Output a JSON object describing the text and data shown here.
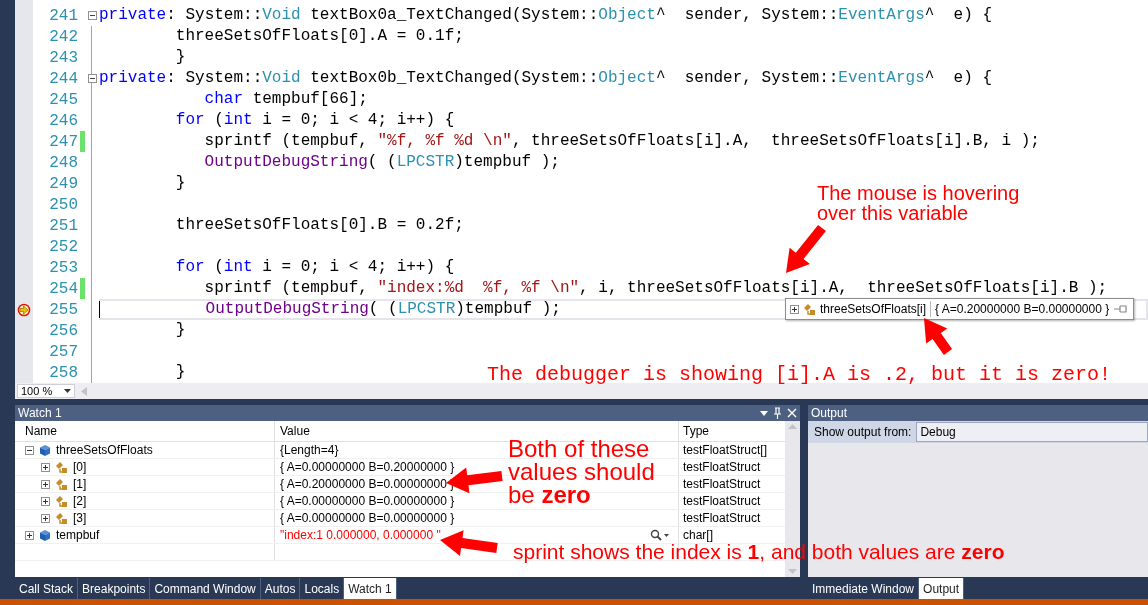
{
  "editor": {
    "lines": [
      {
        "number": "241",
        "collapsible": true,
        "changed": false,
        "current": false,
        "tokens": [
          {
            "kind": "kw",
            "text": "private"
          },
          {
            "kind": "plain",
            "text": ": System::"
          },
          {
            "kind": "type",
            "text": "Void"
          },
          {
            "kind": "plain",
            "text": " textBox0a_TextChanged(System::"
          },
          {
            "kind": "type",
            "text": "Object"
          },
          {
            "kind": "plain",
            "text": "^  sender, System::"
          },
          {
            "kind": "type",
            "text": "EventArgs"
          },
          {
            "kind": "plain",
            "text": "^  e) {"
          }
        ]
      },
      {
        "number": "242",
        "collapsible": false,
        "changed": false,
        "current": false,
        "tokens": [
          {
            "kind": "plain",
            "text": "        threeSetsOfFloats[0].A = 0.1f;"
          }
        ]
      },
      {
        "number": "243",
        "collapsible": false,
        "changed": false,
        "current": false,
        "tokens": [
          {
            "kind": "plain",
            "text": "        }"
          }
        ]
      },
      {
        "number": "244",
        "collapsible": true,
        "changed": false,
        "current": false,
        "tokens": [
          {
            "kind": "kw",
            "text": "private"
          },
          {
            "kind": "plain",
            "text": ": System::"
          },
          {
            "kind": "type",
            "text": "Void"
          },
          {
            "kind": "plain",
            "text": " textBox0b_TextChanged(System::"
          },
          {
            "kind": "type",
            "text": "Object"
          },
          {
            "kind": "plain",
            "text": "^  sender, System::"
          },
          {
            "kind": "type",
            "text": "EventArgs"
          },
          {
            "kind": "plain",
            "text": "^  e) {"
          }
        ]
      },
      {
        "number": "245",
        "collapsible": false,
        "changed": false,
        "current": false,
        "tokens": [
          {
            "kind": "kw",
            "text": "           char"
          },
          {
            "kind": "plain",
            "text": " tempbuf[66];"
          }
        ]
      },
      {
        "number": "246",
        "collapsible": false,
        "changed": false,
        "current": false,
        "tokens": [
          {
            "kind": "kw",
            "text": "        for"
          },
          {
            "kind": "plain",
            "text": " ("
          },
          {
            "kind": "kw",
            "text": "int"
          },
          {
            "kind": "plain",
            "text": " i = 0; i < 4; i++) {"
          }
        ]
      },
      {
        "number": "247",
        "collapsible": false,
        "changed": true,
        "current": false,
        "tokens": [
          {
            "kind": "plain",
            "text": "           sprintf (tempbuf, "
          },
          {
            "kind": "str",
            "text": "\"%f, %f %d \\n\""
          },
          {
            "kind": "plain",
            "text": ", threeSetsOfFloats[i].A,  threeSetsOfFloats[i].B, i );"
          }
        ]
      },
      {
        "number": "248",
        "collapsible": false,
        "changed": false,
        "current": false,
        "tokens": [
          {
            "kind": "fn",
            "text": "           OutputDebugString"
          },
          {
            "kind": "plain",
            "text": "( ("
          },
          {
            "kind": "type",
            "text": "LPCSTR"
          },
          {
            "kind": "plain",
            "text": ")tempbuf );"
          }
        ]
      },
      {
        "number": "249",
        "collapsible": false,
        "changed": false,
        "current": false,
        "tokens": [
          {
            "kind": "plain",
            "text": "        }"
          }
        ]
      },
      {
        "number": "250",
        "collapsible": false,
        "changed": false,
        "current": false
      },
      {
        "number": "251",
        "collapsible": false,
        "changed": false,
        "current": false,
        "tokens": [
          {
            "kind": "plain",
            "text": "        threeSetsOfFloats[0].B = 0.2f;"
          }
        ]
      },
      {
        "number": "252",
        "collapsible": false,
        "changed": false,
        "current": false
      },
      {
        "number": "253",
        "collapsible": false,
        "changed": false,
        "current": false,
        "tokens": [
          {
            "kind": "kw",
            "text": "        for"
          },
          {
            "kind": "plain",
            "text": " ("
          },
          {
            "kind": "kw",
            "text": "int"
          },
          {
            "kind": "plain",
            "text": " i = 0; i < 4; i++) {"
          }
        ]
      },
      {
        "number": "254",
        "collapsible": false,
        "changed": true,
        "current": false,
        "tokens": [
          {
            "kind": "plain",
            "text": "           sprintf (tempbuf, "
          },
          {
            "kind": "str",
            "text": "\"index:%d  %f, %f \\n\""
          },
          {
            "kind": "plain",
            "text": ", i, threeSetsOfFloats[i].A,  threeSetsOfFloats[i].B );"
          }
        ]
      },
      {
        "number": "255",
        "collapsible": false,
        "changed": false,
        "current": true,
        "tokens": [
          {
            "kind": "fn",
            "text": "           OutputDebugString"
          },
          {
            "kind": "plain",
            "text": "( ("
          },
          {
            "kind": "type",
            "text": "LPCSTR"
          },
          {
            "kind": "plain",
            "text": ")tempbuf );"
          }
        ]
      },
      {
        "number": "256",
        "collapsible": false,
        "changed": false,
        "current": false,
        "tokens": [
          {
            "kind": "plain",
            "text": "        }"
          }
        ]
      },
      {
        "number": "257",
        "collapsible": false,
        "changed": false,
        "current": false
      },
      {
        "number": "258",
        "collapsible": false,
        "changed": false,
        "current": false,
        "tokens": [
          {
            "kind": "plain",
            "text": "        }"
          }
        ]
      }
    ],
    "datatip": {
      "name": "threeSetsOfFloats[i]",
      "value": "{ A=0.20000000 B=0.00000000 }"
    },
    "zoom": "100 %"
  },
  "watch": {
    "title": "Watch 1",
    "columns": [
      "Name",
      "Value",
      "Type"
    ],
    "rows": [
      {
        "name": "threeSetsOfFloats",
        "value": "{Length=4}",
        "type": "testFloatStruct[]",
        "kind": "array",
        "expanded": true,
        "changed": false,
        "children": [
          {
            "name": "[0]",
            "value": "{ A=0.00000000 B=0.20000000 }",
            "type": "testFloatStruct",
            "kind": "struct",
            "expanded": false,
            "changed": false
          },
          {
            "name": "[1]",
            "value": "{ A=0.20000000 B=0.00000000 }",
            "type": "testFloatStruct",
            "kind": "struct",
            "expanded": false,
            "changed": false
          },
          {
            "name": "[2]",
            "value": "{ A=0.00000000 B=0.00000000 }",
            "type": "testFloatStruct",
            "kind": "struct",
            "expanded": false,
            "changed": false
          },
          {
            "name": "[3]",
            "value": "{ A=0.00000000 B=0.00000000 }",
            "type": "testFloatStruct",
            "kind": "struct",
            "expanded": false,
            "changed": false
          }
        ]
      },
      {
        "name": "tempbuf",
        "value": "\"index:1  0.000000, 0.000000 \"",
        "type": "char[]",
        "kind": "string",
        "expanded": false,
        "changed": true
      }
    ]
  },
  "output": {
    "title": "Output",
    "source_label": "Show output from:",
    "source": "Debug"
  },
  "left_tabs": [
    {
      "label": "Call Stack",
      "selected": false
    },
    {
      "label": "Breakpoints",
      "selected": false
    },
    {
      "label": "Command Window",
      "selected": false
    },
    {
      "label": "Autos",
      "selected": false
    },
    {
      "label": "Locals",
      "selected": false
    },
    {
      "label": "Watch 1",
      "selected": true
    }
  ],
  "right_tabs": [
    {
      "label": "Immediate Window",
      "selected": false
    },
    {
      "label": "Output",
      "selected": true
    }
  ],
  "annotations": [
    {
      "kind": "sans",
      "text": "The mouse is hovering\nover this variable"
    },
    {
      "kind": "mono",
      "text": "The debugger is showing [i].A is .2, but it is zero!"
    },
    {
      "kind": "sans",
      "text": "Both of these\nvalues should\nbe **zero**"
    },
    {
      "kind": "sans",
      "text": "sprint shows the index is **1**, and both values are **zero**"
    }
  ]
}
